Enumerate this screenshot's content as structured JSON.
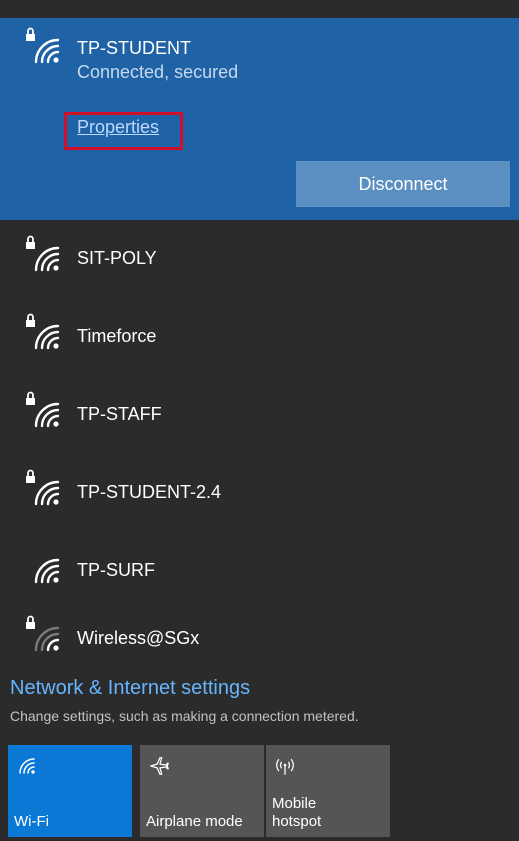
{
  "connected_network": {
    "name": "TP-STUDENT",
    "status": "Connected, secured",
    "properties_link": "Properties",
    "disconnect_button": "Disconnect"
  },
  "networks": [
    {
      "name": "SIT-POLY",
      "secured": true,
      "icon": "wifi-secured-icon"
    },
    {
      "name": "Timeforce",
      "secured": true,
      "icon": "wifi-secured-icon"
    },
    {
      "name": "TP-STAFF",
      "secured": true,
      "icon": "wifi-secured-icon"
    },
    {
      "name": "TP-STUDENT-2.4",
      "secured": true,
      "icon": "wifi-secured-icon"
    },
    {
      "name": "TP-SURF",
      "secured": false,
      "icon": "wifi-open-icon"
    },
    {
      "name": "Wireless@SGx",
      "secured": true,
      "icon": "wifi-weak-secured-icon"
    }
  ],
  "settings": {
    "title": "Network & Internet settings",
    "description": "Change settings, such as making a connection metered."
  },
  "quick_actions": [
    {
      "label": "Wi-Fi",
      "icon": "wifi-icon",
      "active": true
    },
    {
      "label": "Airplane mode",
      "icon": "airplane-icon",
      "active": false
    },
    {
      "label": "Mobile\nhotspot",
      "icon": "hotspot-icon",
      "active": false
    }
  ],
  "colors": {
    "panel_bg": "#2b2b2b",
    "connected_bg": "#1f63a6",
    "accent": "#0a78d4",
    "link": "#67b4ff",
    "highlight_box": "#d0102a"
  }
}
